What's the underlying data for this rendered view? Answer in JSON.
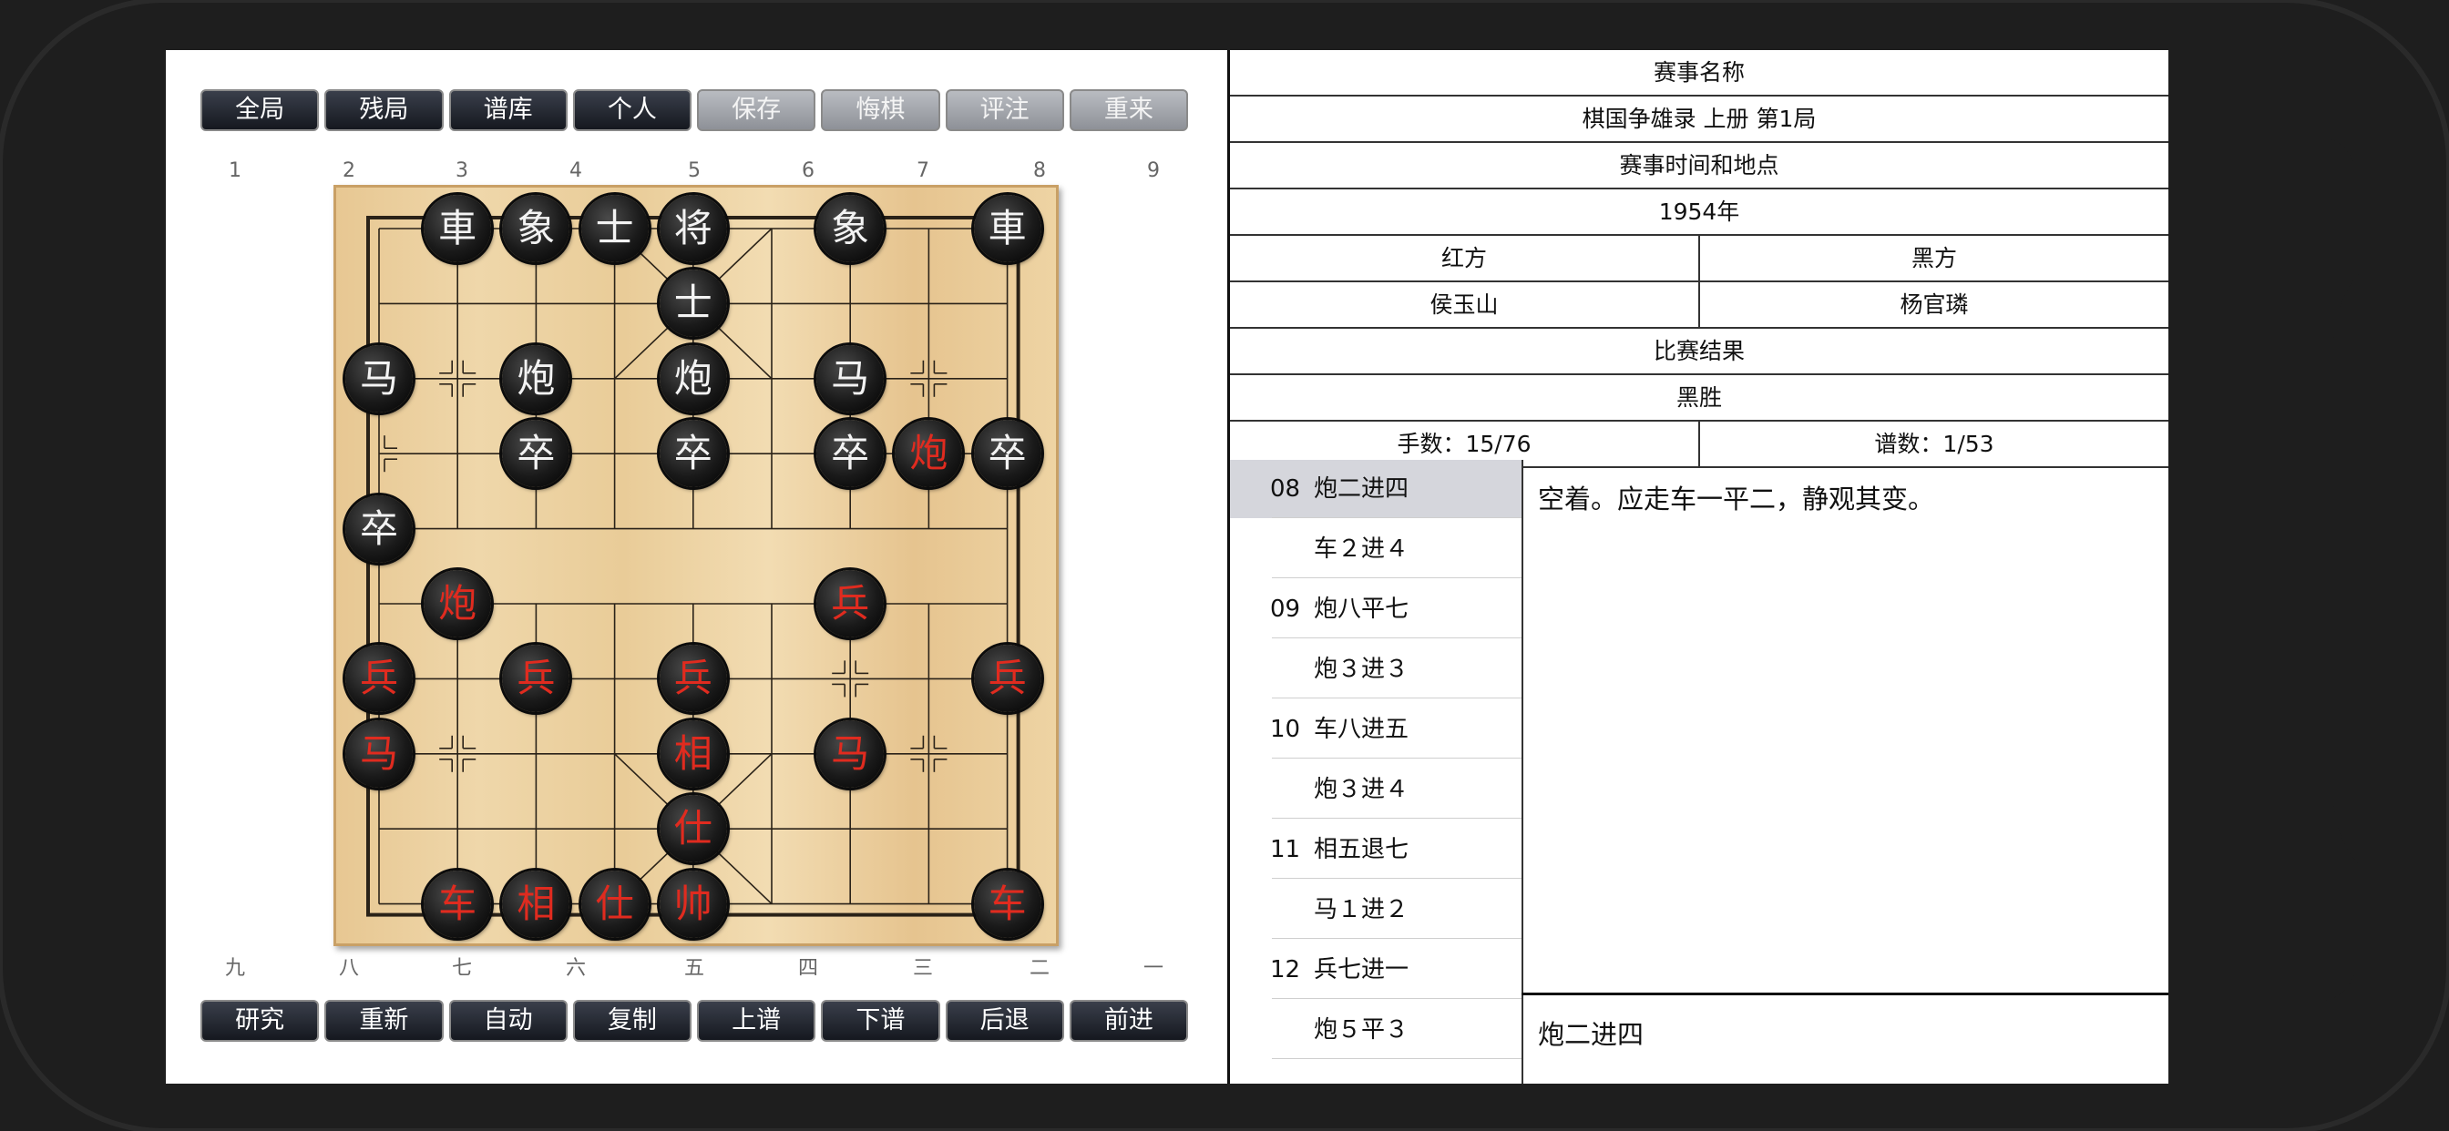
{
  "top_toolbar": [
    {
      "label": "全局",
      "enabled": true
    },
    {
      "label": "残局",
      "enabled": true
    },
    {
      "label": "谱库",
      "enabled": true
    },
    {
      "label": "个人",
      "enabled": true
    },
    {
      "label": "保存",
      "enabled": false
    },
    {
      "label": "悔棋",
      "enabled": false
    },
    {
      "label": "评注",
      "enabled": false
    },
    {
      "label": "重来",
      "enabled": false
    }
  ],
  "bottom_toolbar": [
    {
      "label": "研究"
    },
    {
      "label": "重新"
    },
    {
      "label": "自动"
    },
    {
      "label": "复制"
    },
    {
      "label": "上谱"
    },
    {
      "label": "下谱"
    },
    {
      "label": "后退"
    },
    {
      "label": "前进"
    }
  ],
  "file_labels_top": [
    "1",
    "2",
    "3",
    "4",
    "5",
    "6",
    "7",
    "8",
    "9"
  ],
  "file_labels_bottom": [
    "九",
    "八",
    "七",
    "六",
    "五",
    "四",
    "三",
    "二",
    "一"
  ],
  "board": {
    "pieces": [
      {
        "char": "車",
        "side": "black",
        "file": 1,
        "rank": 0
      },
      {
        "char": "象",
        "side": "black",
        "file": 2,
        "rank": 0
      },
      {
        "char": "士",
        "side": "black",
        "file": 3,
        "rank": 0
      },
      {
        "char": "将",
        "side": "black",
        "file": 4,
        "rank": 0
      },
      {
        "char": "象",
        "side": "black",
        "file": 6,
        "rank": 0
      },
      {
        "char": "車",
        "side": "black",
        "file": 8,
        "rank": 0
      },
      {
        "char": "士",
        "side": "black",
        "file": 4,
        "rank": 1
      },
      {
        "char": "马",
        "side": "black",
        "file": 0,
        "rank": 2
      },
      {
        "char": "炮",
        "side": "black",
        "file": 2,
        "rank": 2
      },
      {
        "char": "炮",
        "side": "black",
        "file": 4,
        "rank": 2
      },
      {
        "char": "马",
        "side": "black",
        "file": 6,
        "rank": 2
      },
      {
        "char": "卒",
        "side": "black",
        "file": 2,
        "rank": 3
      },
      {
        "char": "卒",
        "side": "black",
        "file": 4,
        "rank": 3
      },
      {
        "char": "卒",
        "side": "black",
        "file": 6,
        "rank": 3
      },
      {
        "char": "炮",
        "side": "red",
        "file": 7,
        "rank": 3
      },
      {
        "char": "卒",
        "side": "black",
        "file": 8,
        "rank": 3
      },
      {
        "char": "卒",
        "side": "black",
        "file": 0,
        "rank": 4
      },
      {
        "char": "炮",
        "side": "red",
        "file": 1,
        "rank": 5
      },
      {
        "char": "兵",
        "side": "red",
        "file": 6,
        "rank": 5
      },
      {
        "char": "兵",
        "side": "red",
        "file": 0,
        "rank": 6
      },
      {
        "char": "兵",
        "side": "red",
        "file": 2,
        "rank": 6
      },
      {
        "char": "兵",
        "side": "red",
        "file": 4,
        "rank": 6
      },
      {
        "char": "兵",
        "side": "red",
        "file": 8,
        "rank": 6
      },
      {
        "char": "马",
        "side": "red",
        "file": 0,
        "rank": 7
      },
      {
        "char": "相",
        "side": "red",
        "file": 4,
        "rank": 7
      },
      {
        "char": "马",
        "side": "red",
        "file": 6,
        "rank": 7
      },
      {
        "char": "仕",
        "side": "red",
        "file": 4,
        "rank": 8
      },
      {
        "char": "车",
        "side": "red",
        "file": 1,
        "rank": 9
      },
      {
        "char": "相",
        "side": "red",
        "file": 2,
        "rank": 9
      },
      {
        "char": "仕",
        "side": "red",
        "file": 3,
        "rank": 9
      },
      {
        "char": "帅",
        "side": "red",
        "file": 4,
        "rank": 9
      },
      {
        "char": "车",
        "side": "red",
        "file": 8,
        "rank": 9
      }
    ]
  },
  "game_info": {
    "event_label": "赛事名称",
    "event_value": "棋国争雄录 上册 第1局",
    "time_place_label": "赛事时间和地点",
    "time_place_value": "1954年",
    "red_label": "红方",
    "black_label": "黑方",
    "red_player": "侯玉山",
    "black_player": "杨官璘",
    "result_label": "比赛结果",
    "result_value": "黑胜",
    "move_count": "手数：15/76",
    "record_count": "谱数：1/53"
  },
  "moves": [
    {
      "num": "08",
      "text": "炮二进四",
      "selected": true
    },
    {
      "num": "",
      "text": "车２进４",
      "selected": false
    },
    {
      "num": "09",
      "text": "炮八平七",
      "selected": false
    },
    {
      "num": "",
      "text": "炮３进３",
      "selected": false
    },
    {
      "num": "10",
      "text": "车八进五",
      "selected": false
    },
    {
      "num": "",
      "text": "炮３进４",
      "selected": false
    },
    {
      "num": "11",
      "text": "相五退七",
      "selected": false
    },
    {
      "num": "",
      "text": "马１进２",
      "selected": false
    },
    {
      "num": "12",
      "text": "兵七进一",
      "selected": false
    },
    {
      "num": "",
      "text": "炮５平３",
      "selected": false
    }
  ],
  "comment": "空着。应走车一平二，静观其变。",
  "current_move": "炮二进四"
}
